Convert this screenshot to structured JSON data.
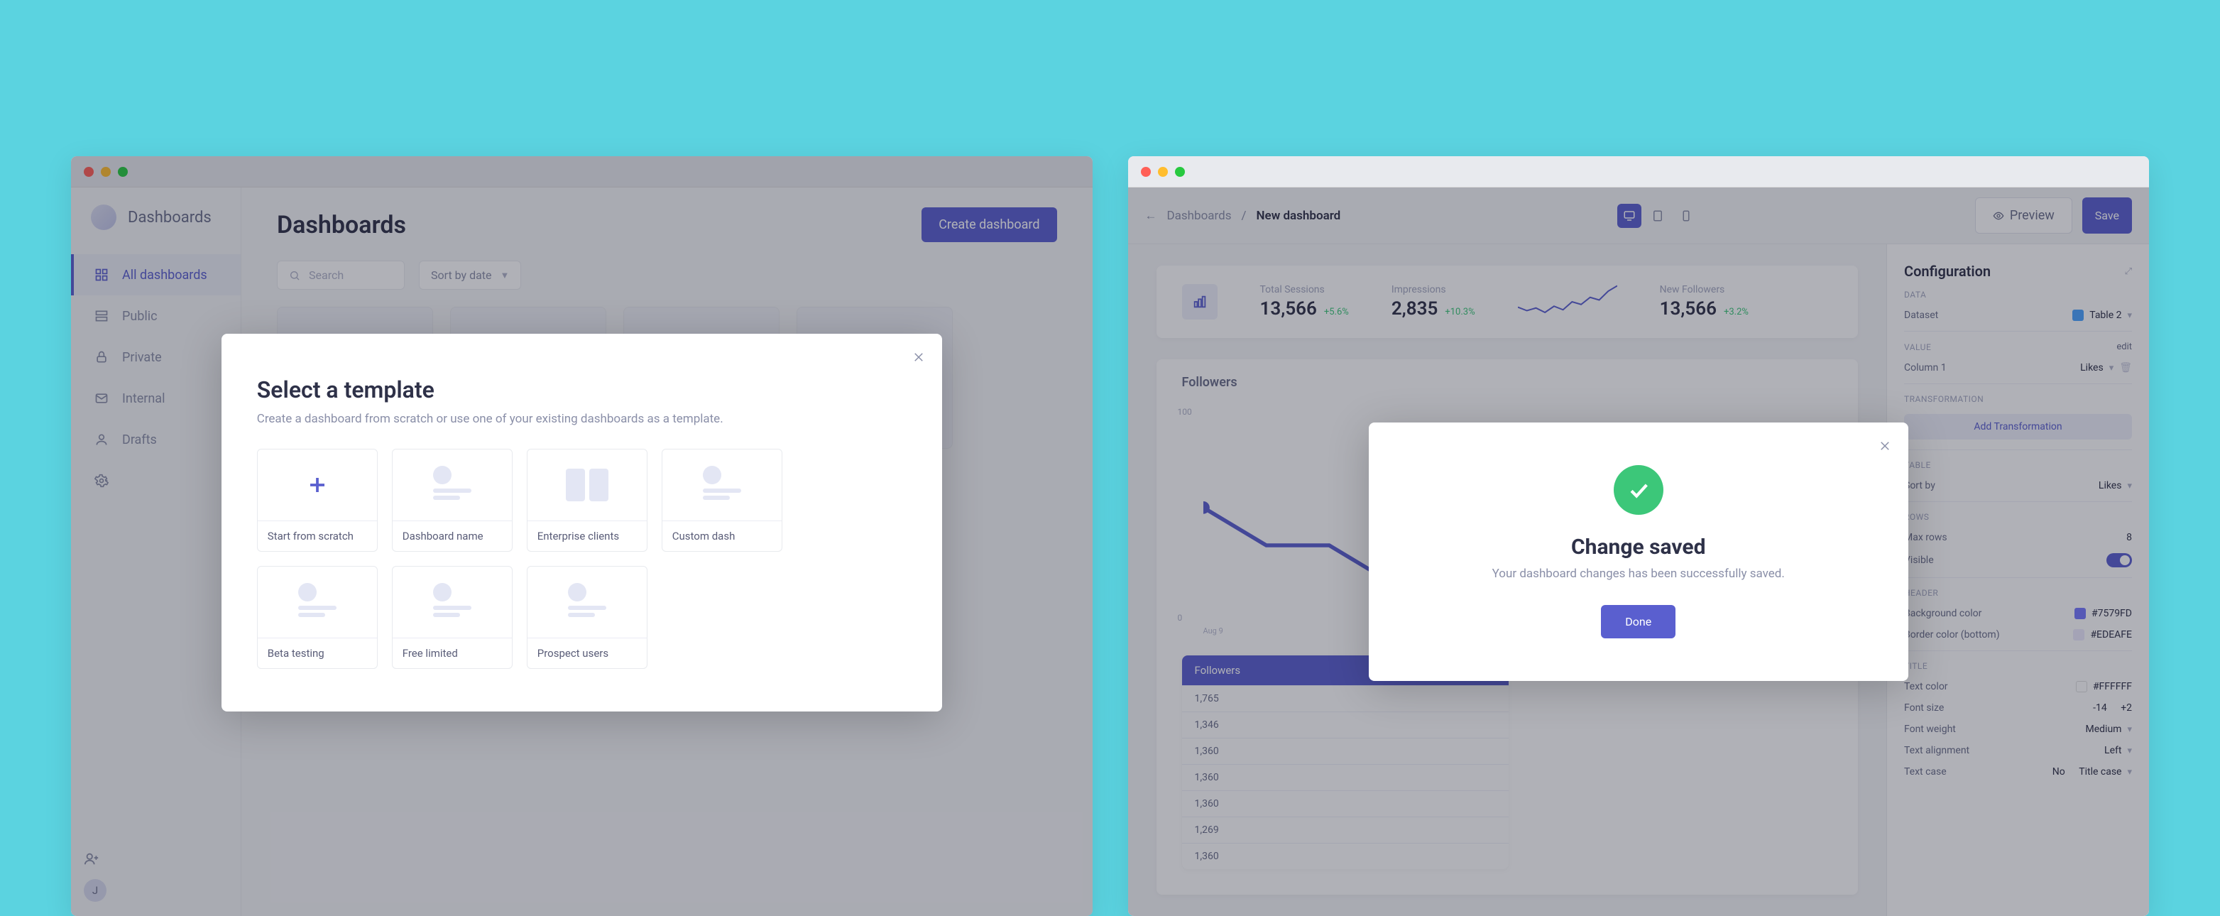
{
  "left": {
    "brand": "Dashboards",
    "nav": {
      "items": [
        {
          "label": "All dashboards"
        },
        {
          "label": "Public"
        },
        {
          "label": "Private"
        },
        {
          "label": "Internal"
        },
        {
          "label": "Drafts"
        }
      ]
    },
    "avatar_initial": "J",
    "header": {
      "title": "Dashboards",
      "create_btn": "Create dashboard"
    },
    "toolbar": {
      "search_placeholder": "Search",
      "sort_label": "Sort by date"
    },
    "card_cta": "Create dashboard",
    "modal": {
      "title": "Select a template",
      "description": "Create a dashboard from scratch or use one of your existing dashboards as a template.",
      "templates": [
        {
          "label": "Start from scratch"
        },
        {
          "label": "Dashboard name"
        },
        {
          "label": "Enterprise clients"
        },
        {
          "label": "Custom dash"
        },
        {
          "label": "Beta testing"
        },
        {
          "label": "Free limited"
        },
        {
          "label": "Prospect users"
        }
      ]
    }
  },
  "right": {
    "breadcrumb": {
      "back_icon": "←",
      "root": "Dashboards",
      "sep": "/",
      "current": "New dashboard"
    },
    "top_actions": {
      "preview": "Preview",
      "save": "Save"
    },
    "stats": [
      {
        "label": "Total Sessions",
        "value": "13,566",
        "delta": "+5.6%"
      },
      {
        "label": "Impressions",
        "value": "2,835",
        "delta": "+10.3%"
      },
      {
        "label": "New Followers",
        "value": "13,566",
        "delta": "+3.2%"
      }
    ],
    "followers": {
      "title": "Followers",
      "yticks": {
        "top": "100",
        "bottom": "0"
      },
      "xhint": "Aug 9"
    },
    "table": {
      "header": "Followers",
      "rows": [
        "1,765",
        "1,346",
        "1,360",
        "1,360",
        "1,360",
        "1,269",
        "1,360"
      ]
    },
    "config": {
      "title": "Configuration",
      "data_label": "Data",
      "dataset_label": "Dataset",
      "dataset_value": "Table 2",
      "value_label": "VALUE",
      "value_edit": "edit",
      "column_label": "Column 1",
      "column_value": "Likes",
      "transformation_label": "TRANSFORMATION",
      "add_transformation": "Add Transformation",
      "table_section": "TABLE",
      "sortby_label": "Sort by",
      "sortby_value": "Likes",
      "rows_section": "ROWS",
      "maxrows_label": "Max rows",
      "maxrows_value": "8",
      "visible_label": "Visible",
      "header_section": "HEADER",
      "bg_label": "Background color",
      "bg_value": "#7579FD",
      "border_label": "Border color (bottom)",
      "border_value": "#EDEAFE",
      "title_section": "TITLE",
      "textcolor_label": "Text color",
      "textcolor_value": "#FFFFFF",
      "fontsize_label": "Font size",
      "fontsize_minus": "-14",
      "fontsize_plus": "+2",
      "fontweight_label": "Font weight",
      "fontweight_value": "Medium",
      "textalign_label": "Text alignment",
      "textalign_value": "Left",
      "textcase_label": "Text case",
      "textcase_no": "No",
      "textcase_value": "Title case"
    },
    "modal": {
      "title": "Change saved",
      "description": "Your dashboard changes has been successfully saved.",
      "done": "Done"
    }
  },
  "chart_data": [
    {
      "type": "line",
      "title": "Sparkline",
      "x": [
        0,
        1,
        2,
        3,
        4,
        5,
        6,
        7,
        8,
        9,
        10,
        11
      ],
      "values": [
        34,
        30,
        33,
        28,
        35,
        31,
        40,
        37,
        45,
        42,
        52,
        58
      ],
      "ylim": [
        20,
        60
      ]
    },
    {
      "type": "line",
      "title": "Followers",
      "x": [
        0,
        1,
        2,
        3,
        4,
        5,
        6,
        7,
        8,
        9,
        10
      ],
      "values": [
        60,
        45,
        45,
        30,
        38,
        40,
        35,
        42,
        48,
        44,
        46
      ],
      "ylabel": "",
      "ylim": [
        0,
        100
      ]
    }
  ]
}
